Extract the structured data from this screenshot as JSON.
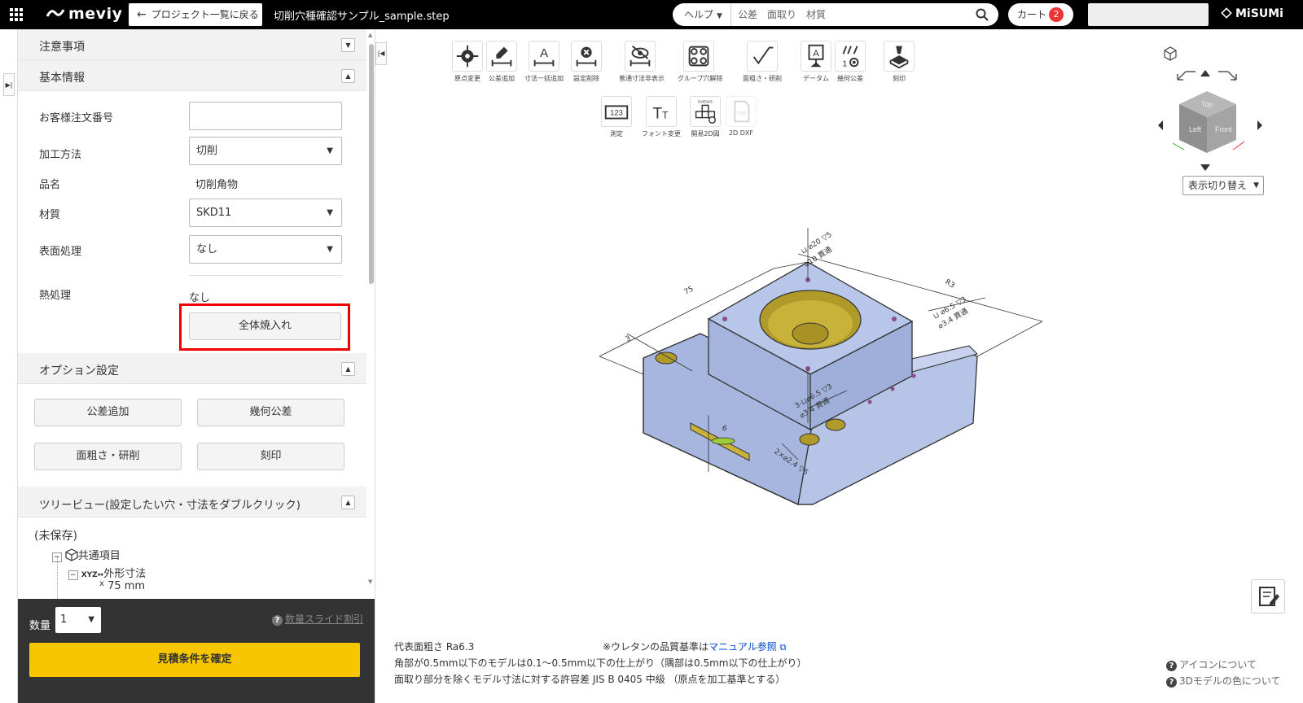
{
  "topbar": {
    "logo": "meviy",
    "back_label": "プロジェクト一覧に戻る",
    "file_title": "切削穴種確認サンプル_sample.step",
    "help_label": "ヘルプ",
    "search_placeholder": "公差　面取り　材質",
    "cart_label": "カート",
    "cart_count": "2",
    "brand": "MiSUMi"
  },
  "panel": {
    "notes_title": "注意事項",
    "basic_title": "基本情報",
    "fields": {
      "order_no_label": "お客様注文番号",
      "order_no_value": "",
      "method_label": "加工方法",
      "method_value": "切削",
      "name_label": "品名",
      "name_value": "切削角物",
      "material_label": "材質",
      "material_value": "SKD11",
      "surface_label": "表面処理",
      "surface_value": "なし",
      "heat_label": "熱処理",
      "heat_value": "なし",
      "quench_button": "全体焼入れ"
    },
    "options_title": "オプション設定",
    "options": [
      "公差追加",
      "幾何公差",
      "面粗さ・研削",
      "刻印"
    ],
    "tree_title": "ツリービュー(設定したい穴・寸法をダブルクリック)",
    "tree": {
      "root": "(未保存)",
      "common": "共通項目",
      "outer": "外形寸法",
      "x_label": "x",
      "x_value": "75 mm"
    }
  },
  "order": {
    "qty_label": "数量",
    "qty_value": "1",
    "slide_discount": "数量スライド割引",
    "confirm": "見積条件を確定"
  },
  "toolbar": {
    "row1": [
      "原点変更",
      "公差追加",
      "寸法一括追加",
      "設定削除",
      "普通寸法非表示",
      "グループ穴解除",
      "面粗さ・研削",
      "データム",
      "幾何公差",
      "刻印"
    ],
    "row2": [
      "測定",
      "フォント変更",
      "開易2D図",
      "2D DXF"
    ]
  },
  "viewcube": {
    "switch_label": "表示切り替え",
    "faces": [
      "Top",
      "Left",
      "Front"
    ]
  },
  "model_annotations": {
    "dim_75": "75",
    "dim_3": "3",
    "hole_top": "⊔ ⌀20 ▽5",
    "hole_top2": "⌀10 貫通",
    "hole_right": "⊔ ⌀6.5 ▽3",
    "hole_right2": "⌀3.4 貫通",
    "hole_mid": "3-⊔⌀6.5 ▽3",
    "hole_mid2": "⌀3.4 貫通",
    "hole_bottom": "2×⌀2.4 ▽6",
    "dim_6": "6",
    "dim_r": "R3"
  },
  "footer": {
    "ra": "代表面粗さ Ra6.3",
    "urethane_pre": "※ウレタンの品質基準は",
    "urethane_link": "マニュアル参照",
    "corner": "角部が0.5mm以下のモデルは0.1～0.5mm以下の仕上がり（隅部は0.5mm以下の仕上がり）",
    "tolerance": "面取り部分を除くモデル寸法に対する許容差 JIS B 0405 中級 （原点を加工基準とする）",
    "icon_help": "アイコンについて",
    "color_help": "3Dモデルの色について"
  },
  "colors": {
    "topbar": "#000000",
    "accent": "#f7c600",
    "highlight": "#ee0000",
    "model": "#a8b8e0",
    "hole": "#b8a030"
  }
}
